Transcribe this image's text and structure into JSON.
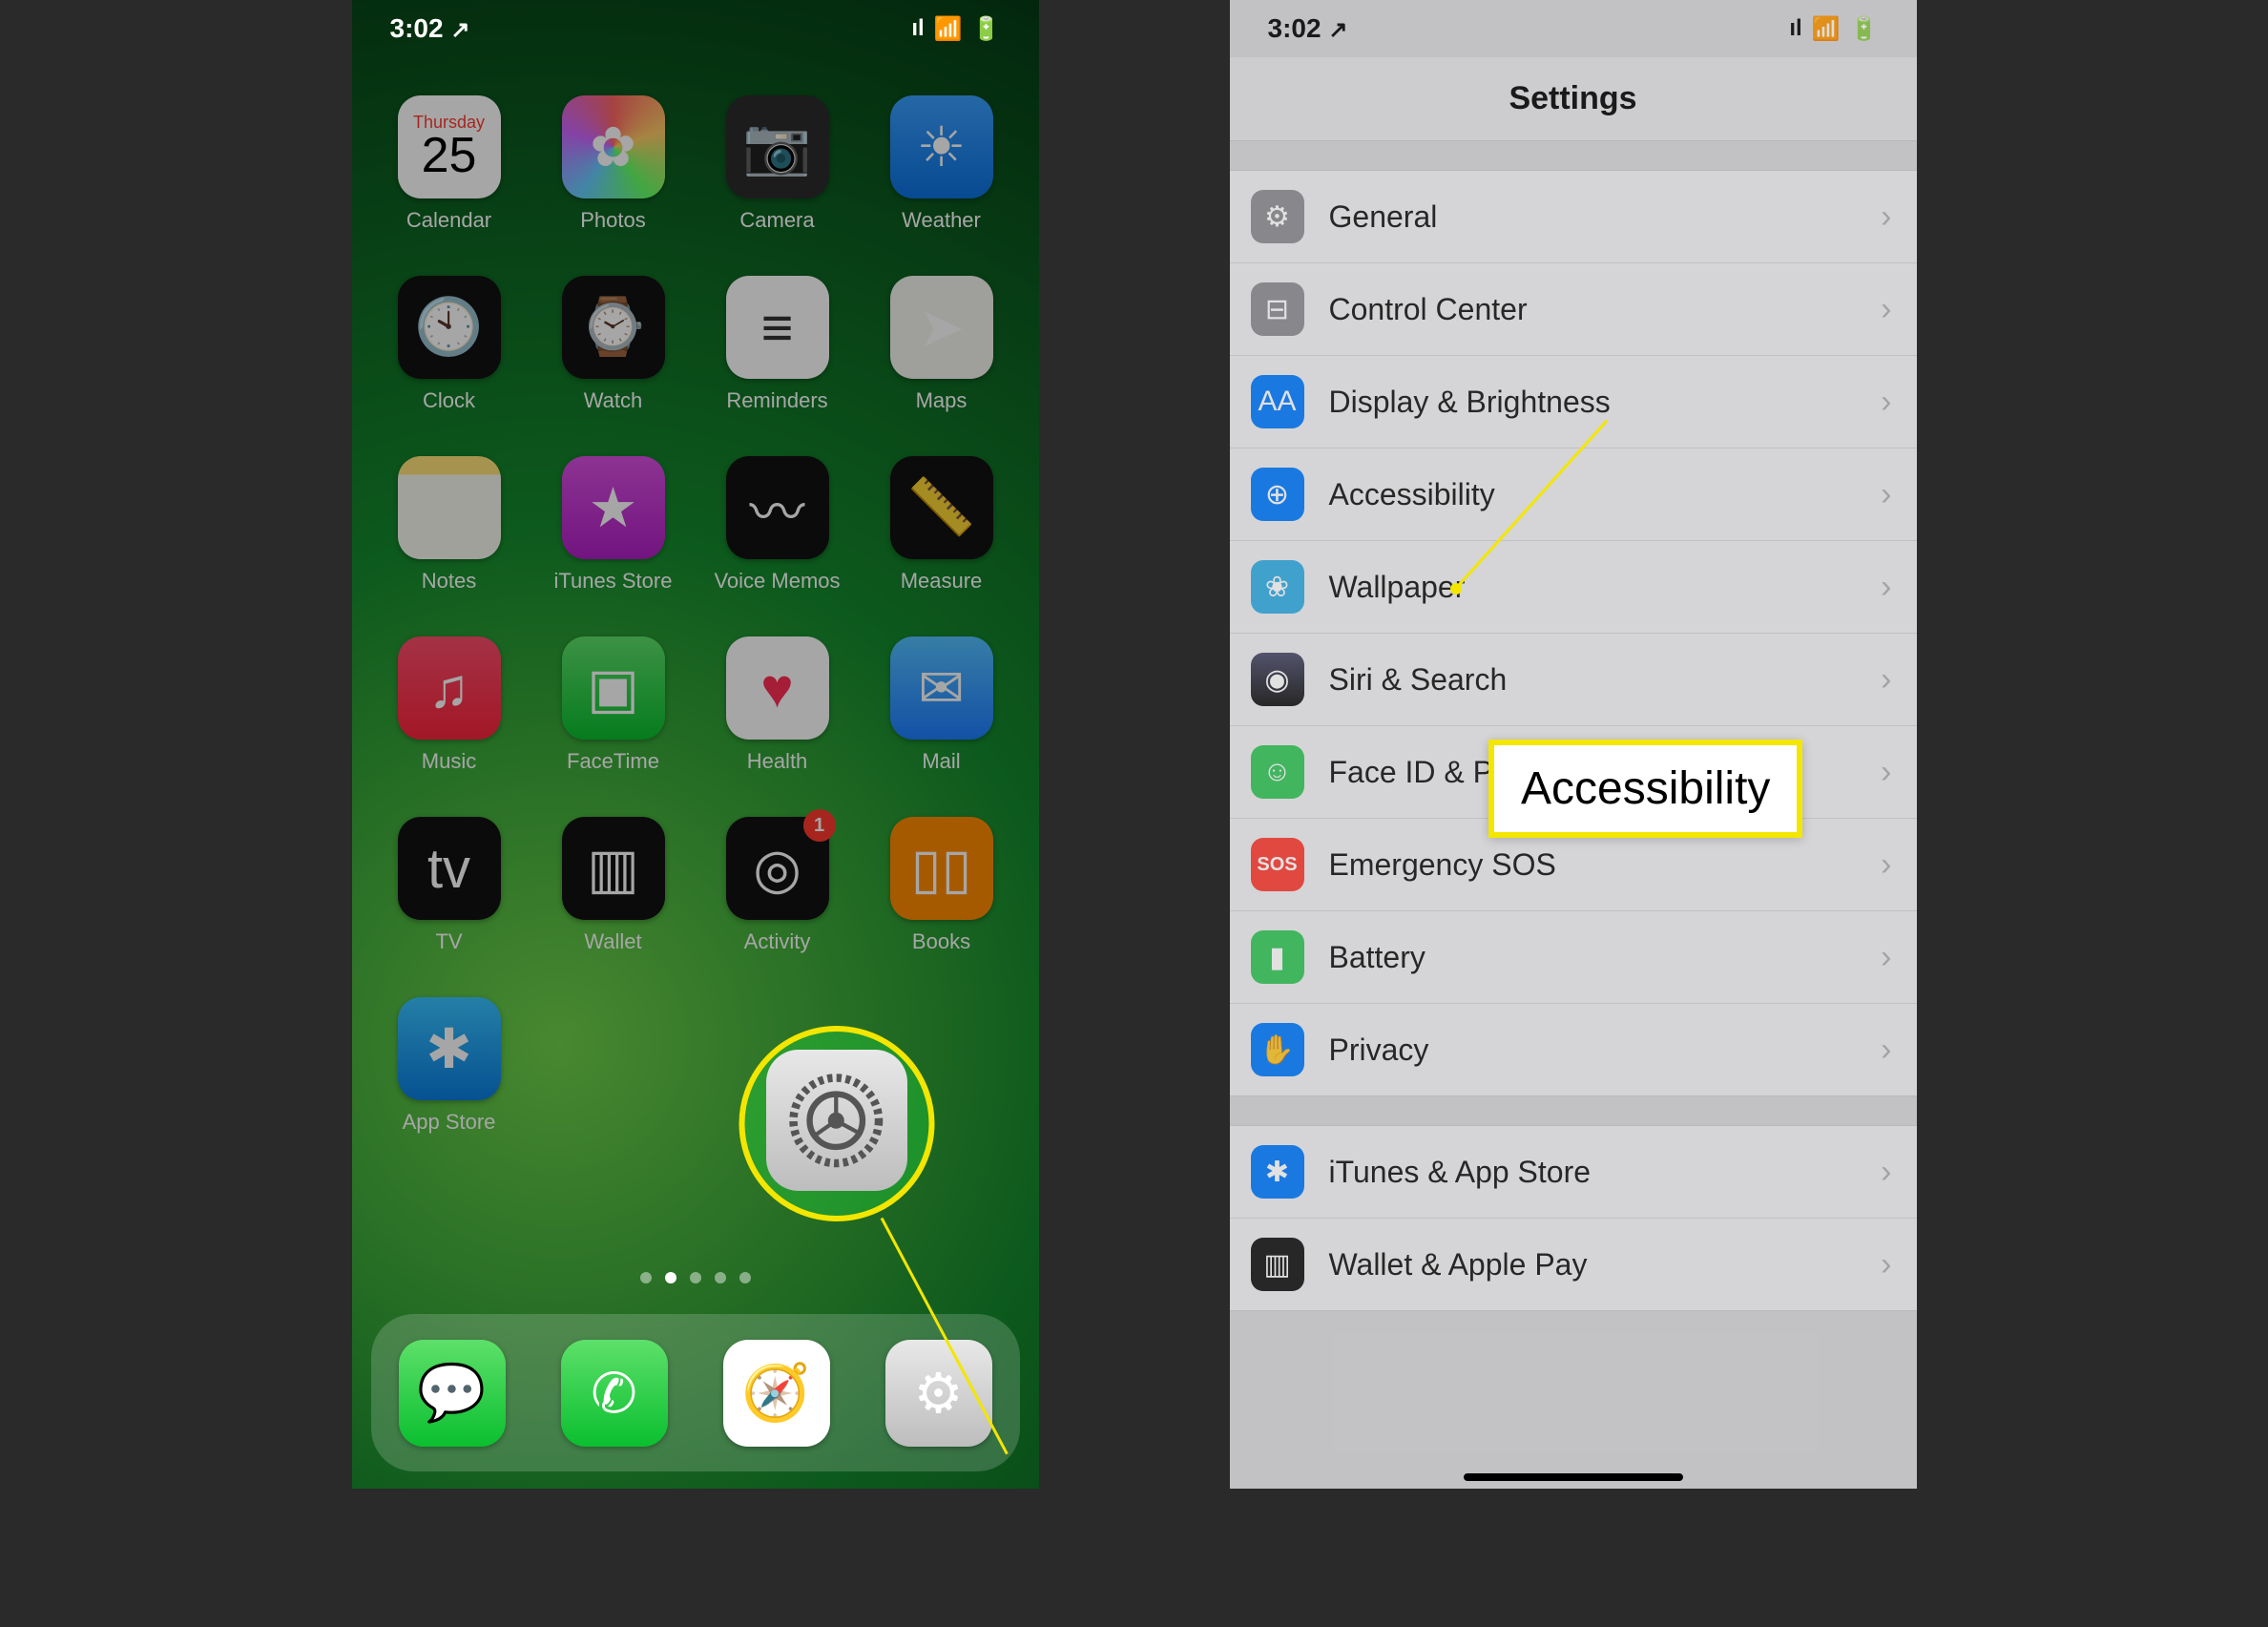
{
  "status": {
    "time": "3:02",
    "location_icon": "↗",
    "signal": "ıl",
    "wifi": "⚬",
    "battery": "▮▯"
  },
  "home": {
    "apps": [
      {
        "label": "Calendar",
        "icon": "",
        "bg": "bg-white",
        "name": "calendar-app",
        "cal_day": "Thursday",
        "cal_date": "25"
      },
      {
        "label": "Photos",
        "icon": "✿",
        "bg": "bg-photos",
        "name": "photos-app"
      },
      {
        "label": "Camera",
        "icon": "📷",
        "bg": "bg-dark",
        "name": "camera-app"
      },
      {
        "label": "Weather",
        "icon": "☀",
        "bg": "bg-weather",
        "name": "weather-app"
      },
      {
        "label": "Clock",
        "icon": "🕙",
        "bg": "bg-clock",
        "name": "clock-app"
      },
      {
        "label": "Watch",
        "icon": "⌚",
        "bg": "bg-watch",
        "name": "watch-app"
      },
      {
        "label": "Reminders",
        "icon": "≡",
        "bg": "bg-white",
        "name": "reminders-app"
      },
      {
        "label": "Maps",
        "icon": "➤",
        "bg": "bg-maps",
        "name": "maps-app"
      },
      {
        "label": "Notes",
        "icon": "",
        "bg": "bg-notes",
        "name": "notes-app"
      },
      {
        "label": "iTunes Store",
        "icon": "★",
        "bg": "bg-itunes",
        "name": "itunes-store-app"
      },
      {
        "label": "Voice Memos",
        "icon": "〰",
        "bg": "bg-voice",
        "name": "voice-memos-app"
      },
      {
        "label": "Measure",
        "icon": "📏",
        "bg": "bg-measure",
        "name": "measure-app"
      },
      {
        "label": "Music",
        "icon": "♫",
        "bg": "bg-music",
        "name": "music-app"
      },
      {
        "label": "FaceTime",
        "icon": "▣",
        "bg": "bg-ft",
        "name": "facetime-app"
      },
      {
        "label": "Health",
        "icon": "♥",
        "bg": "bg-health",
        "name": "health-app",
        "fg": "#ff2d55"
      },
      {
        "label": "Mail",
        "icon": "✉",
        "bg": "bg-mail",
        "name": "mail-app"
      },
      {
        "label": "TV",
        "icon": "tv",
        "bg": "bg-tv",
        "name": "tv-app"
      },
      {
        "label": "Wallet",
        "icon": "▥",
        "bg": "bg-wallet",
        "name": "wallet-app"
      },
      {
        "label": "Activity",
        "icon": "◎",
        "bg": "bg-activity",
        "name": "activity-app",
        "badge": "1"
      },
      {
        "label": "Books",
        "icon": "▯▯",
        "bg": "bg-books",
        "name": "books-app"
      },
      {
        "label": "App Store",
        "icon": "✱",
        "bg": "bg-appstore",
        "name": "app-store-app"
      }
    ],
    "dock": [
      {
        "name": "messages-app",
        "icon": "💬",
        "bg": "bg-msg"
      },
      {
        "name": "phone-app",
        "icon": "✆",
        "bg": "bg-phone"
      },
      {
        "name": "safari-app",
        "icon": "🧭",
        "bg": "bg-safari"
      },
      {
        "name": "settings-app",
        "icon": "⚙",
        "bg": "bg-settings"
      }
    ],
    "page_count": 5,
    "active_page": 1
  },
  "settings": {
    "title": "Settings",
    "groups": [
      [
        {
          "label": "General",
          "icon": "⚙",
          "cls": "ic-general",
          "name": "settings-general"
        },
        {
          "label": "Control Center",
          "icon": "⊟",
          "cls": "ic-cc",
          "name": "settings-control-center"
        },
        {
          "label": "Display & Brightness",
          "icon": "AA",
          "cls": "ic-display",
          "name": "settings-display"
        },
        {
          "label": "Accessibility",
          "icon": "⊕",
          "cls": "ic-access",
          "name": "settings-accessibility"
        },
        {
          "label": "Wallpaper",
          "icon": "❀",
          "cls": "ic-wall",
          "name": "settings-wallpaper"
        },
        {
          "label": "Siri & Search",
          "icon": "◉",
          "cls": "ic-siri",
          "name": "settings-siri"
        },
        {
          "label": "Face ID & Passcode",
          "icon": "☺",
          "cls": "ic-face",
          "name": "settings-faceid"
        },
        {
          "label": "Emergency SOS",
          "icon": "SOS",
          "cls": "ic-sos",
          "name": "settings-sos"
        },
        {
          "label": "Battery",
          "icon": "▮",
          "cls": "ic-battery",
          "name": "settings-battery"
        },
        {
          "label": "Privacy",
          "icon": "✋",
          "cls": "ic-privacy",
          "name": "settings-privacy"
        }
      ],
      [
        {
          "label": "iTunes & App Store",
          "icon": "✱",
          "cls": "ic-itunes",
          "name": "settings-itunes-appstore"
        },
        {
          "label": "Wallet & Apple Pay",
          "icon": "▥",
          "cls": "ic-wpay",
          "name": "settings-wallet-pay"
        }
      ]
    ]
  },
  "annotation": {
    "callout_text": "Accessibility"
  }
}
